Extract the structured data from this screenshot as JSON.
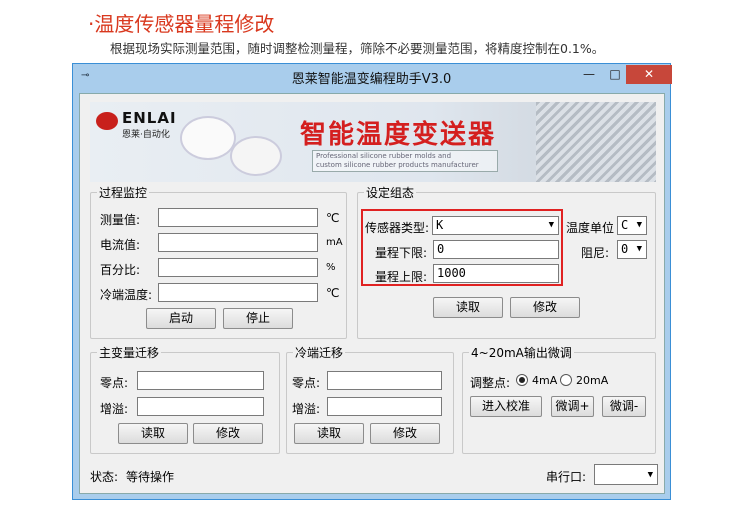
{
  "heading": "·温度传感器量程修改",
  "subtitle": "根据现场实际测量范围，随时调整检测量程，筛除不必要测量范围，将精度控制在0.1%。",
  "window": {
    "title": "恩莱智能温变编程助手V3.0",
    "app_icon": "app-icon",
    "minimize": "—",
    "maximize": "□",
    "close": "✕"
  },
  "banner": {
    "logo": "ENLAI",
    "logo_sub": "恩莱·自动化",
    "title": "智能温度变送器",
    "tag_line1": "Professional silicone rubber molds and",
    "tag_line2": "custom silicone rubber products manufacturer"
  },
  "process": {
    "legend": "过程监控",
    "measure_label": "测量值:",
    "measure_unit": "℃",
    "current_label": "电流值:",
    "current_unit": "mA",
    "percent_label": "百分比:",
    "percent_unit": "%",
    "cold_label": "冷端温度:",
    "cold_unit": "℃",
    "start": "启动",
    "stop": "停止"
  },
  "settings": {
    "legend": "设定组态",
    "sensor_label": "传感器类型:",
    "sensor_value": "K",
    "lower_label": "量程下限:",
    "lower_value": "0",
    "upper_label": "量程上限:",
    "upper_value": "1000",
    "temp_unit_label": "温度单位",
    "temp_unit_value": "C",
    "damping_label": "阻尼:",
    "damping_value": "0",
    "read": "读取",
    "modify": "修改"
  },
  "main_var": {
    "legend": "主变量迁移",
    "zero_label": "零点:",
    "gain_label": "增溢:",
    "read": "读取",
    "modify": "修改"
  },
  "cold_shift": {
    "legend": "冷端迁移",
    "zero_label": "零点:",
    "gain_label": "增溢:",
    "read": "读取",
    "modify": "修改"
  },
  "output_trim": {
    "legend": "4~20mA输出微调",
    "point_label": "调整点:",
    "opt_4": "4mA",
    "opt_20": "20mA",
    "selected": "4mA",
    "enter": "进入校准",
    "trim_up": "微调+",
    "trim_down": "微调-"
  },
  "status": {
    "label": "状态:",
    "value": "等待操作",
    "port_label": "串行口:",
    "port_value": ""
  }
}
